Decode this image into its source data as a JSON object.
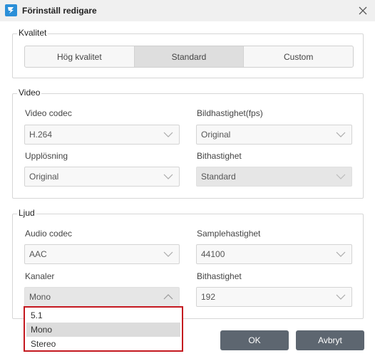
{
  "window": {
    "title": "Förinställ redigare"
  },
  "kvalitet": {
    "legend": "Kvalitet",
    "options": [
      "Hög kvalitet",
      "Standard",
      "Custom"
    ],
    "selected": "Standard"
  },
  "video": {
    "legend": "Video",
    "codec": {
      "label": "Video codec",
      "value": "H.264"
    },
    "fps": {
      "label": "Bildhastighet(fps)",
      "value": "Original"
    },
    "resolution": {
      "label": "Upplösning",
      "value": "Original"
    },
    "bitrate": {
      "label": "Bithastighet",
      "value": "Standard"
    }
  },
  "audio": {
    "legend": "Ljud",
    "codec": {
      "label": "Audio codec",
      "value": "AAC"
    },
    "samplerate": {
      "label": "Samplehastighet",
      "value": "44100"
    },
    "channels": {
      "label": "Kanaler",
      "value": "Mono",
      "options": [
        "5.1",
        "Mono",
        "Stereo"
      ]
    },
    "bitrate": {
      "label": "Bithastighet",
      "value": "192"
    }
  },
  "buttons": {
    "ok": "OK",
    "cancel": "Avbryt"
  },
  "colors": {
    "accent": "#2b8fd8",
    "button": "#5d6670",
    "highlight_border": "#c4181f"
  },
  "icons": {
    "app": "app-logo-icon",
    "close": "close-icon",
    "dropdown": "chevron-down-icon",
    "dropdown_open": "chevron-up-icon"
  }
}
